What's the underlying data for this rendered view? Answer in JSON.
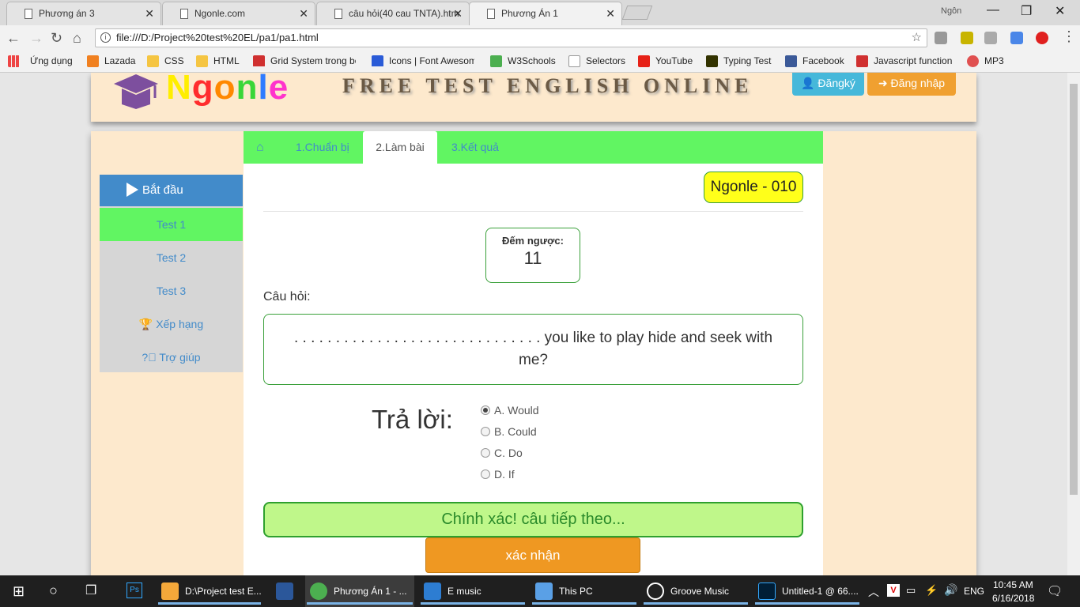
{
  "browser": {
    "tabs": [
      {
        "title": "Phương án 3"
      },
      {
        "title": "Ngonle.com"
      },
      {
        "title": "câu hỏi(40 cau TNTA).htm"
      },
      {
        "title": "Phương Án 1"
      }
    ],
    "user": "Ngôn",
    "url": "file:///D:/Project%20test%20EL/pa1/pa1.html",
    "bookmarks": [
      {
        "label": "Ứng dụng",
        "color": "#e04040"
      },
      {
        "label": "Lazada",
        "color": "#f08020"
      },
      {
        "label": "CSS",
        "color": "#f5c542"
      },
      {
        "label": "HTML",
        "color": "#f5c542"
      },
      {
        "label": "Grid System trong bo",
        "color": "#d03030"
      },
      {
        "label": "Icons | Font Awesom",
        "color": "#2a5bd7"
      },
      {
        "label": "W3Schools",
        "color": "#4caf50"
      },
      {
        "label": "Selectors",
        "color": "#222222"
      },
      {
        "label": "YouTube",
        "color": "#e62117"
      },
      {
        "label": "Typing Test",
        "color": "#333300"
      },
      {
        "label": "Facebook",
        "color": "#3b5998"
      },
      {
        "label": "Javascript function",
        "color": "#d03030"
      },
      {
        "label": "MP3",
        "color": "#e05050"
      }
    ]
  },
  "site": {
    "logo_letters": [
      "N",
      "g",
      "o",
      "n",
      "l",
      "e"
    ],
    "logo_colors": [
      "#ffee00",
      "#ff2d2d",
      "#ff8800",
      "#39d639",
      "#2e7bff",
      "#ff33cc"
    ],
    "title": "FREE TEST ENGLISH ONLINE",
    "register_label": "Đăngký",
    "login_label": "Đăng nhập"
  },
  "sidebar": {
    "start_label": "Bắt đầu",
    "items": [
      {
        "label": "Test 1",
        "active": true
      },
      {
        "label": "Test 2",
        "active": false
      },
      {
        "label": "Test 3",
        "active": false
      },
      {
        "label": "Xếp hạng",
        "icon": "trophy-icon"
      },
      {
        "label": "Trợ giúp",
        "icon": "question-circle-icon"
      }
    ]
  },
  "steps": {
    "home_icon": "home-icon",
    "tabs": [
      "1.Chuẩn bị",
      "2.Làm bài",
      "3.Kết quả"
    ],
    "active_index": 1
  },
  "quiz": {
    "code": "Ngonle - 010",
    "countdown_label": "Đếm ngược:",
    "countdown_value": "11",
    "question_label": "Câu hỏi:",
    "question_text": ". . . . . . . . . . . . . . . . . . . . . . . . . . . . . . you like to play hide and seek with me?",
    "answer_label": "Trả lời:",
    "options": [
      "A. Would",
      "B. Could",
      "C. Do",
      "D. If"
    ],
    "selected_option": 0,
    "result_text": "Chính xác! câu tiếp theo...",
    "confirm_label": "xác nhận"
  },
  "taskbar": {
    "items": [
      {
        "label": "D:\\Project test E...",
        "color": "#f4a83a"
      },
      {
        "label": "",
        "color": "#2b579a"
      },
      {
        "label": "Phương Án 1 - ...",
        "color": "#4caf50"
      },
      {
        "label": "E music",
        "color": "#2d7dd2"
      },
      {
        "label": "This PC",
        "color": "#5aa0e6"
      },
      {
        "label": "Groove Music",
        "color": "#222222"
      },
      {
        "label": "Untitled-1 @ 66....",
        "color": "#001e36"
      }
    ],
    "language": "ENG",
    "time": "10:45 AM",
    "date": "6/16/2018"
  }
}
